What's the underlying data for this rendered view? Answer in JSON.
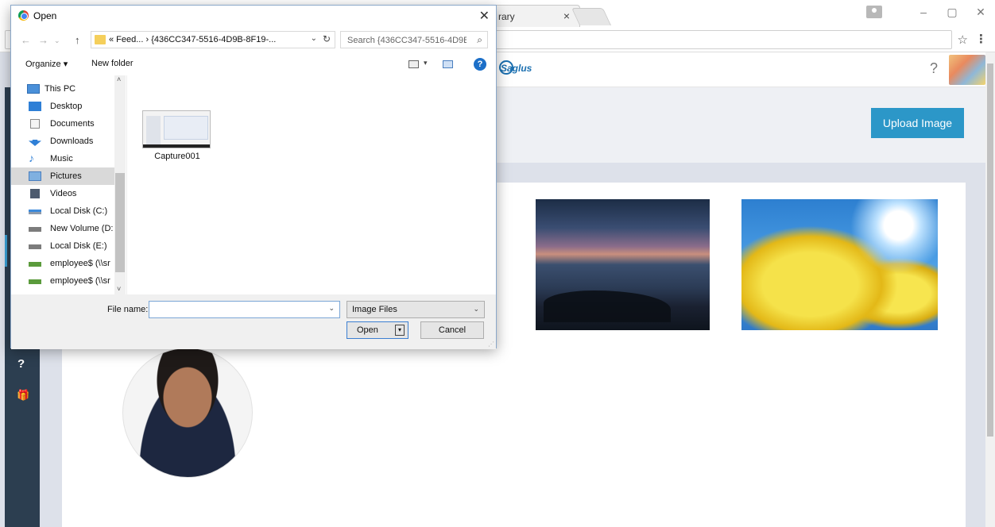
{
  "browser": {
    "active_tab_title": "rary",
    "tab_close": "×",
    "window_minimize": "–",
    "window_restore": "▢",
    "window_close": "✕",
    "star": "☆",
    "menu": "⋮"
  },
  "page": {
    "logo_text": "Saglus",
    "help": "?",
    "upload_button": "Upload Image",
    "sidebar_help": "?",
    "sidebar_gift": "🎁"
  },
  "dialog": {
    "title": "Open",
    "close": "✕",
    "nav": {
      "back": "←",
      "forward": "→",
      "recent": "⌄",
      "up": "↑"
    },
    "path": "« Feed... › {436CC347-5516-4D9B-8F19-...",
    "path_dropdown": "⌄",
    "refresh": "↻",
    "search_placeholder": "Search {436CC347-5516-4D9B...",
    "search_icon": "⌕",
    "organize": "Organize ▾",
    "new_folder": "New folder",
    "view_drop": "▾",
    "help": "?",
    "nav_items": [
      {
        "label": "This PC",
        "icon": "computer-icon"
      },
      {
        "label": "Desktop",
        "icon": "desktop-icon"
      },
      {
        "label": "Documents",
        "icon": "documents-icon"
      },
      {
        "label": "Downloads",
        "icon": "downloads-icon"
      },
      {
        "label": "Music",
        "icon": "music-icon"
      },
      {
        "label": "Pictures",
        "icon": "pictures-icon",
        "selected": true
      },
      {
        "label": "Videos",
        "icon": "videos-icon"
      },
      {
        "label": "Local Disk (C:)",
        "icon": "drive-icon"
      },
      {
        "label": "New Volume (D:",
        "icon": "drive-icon"
      },
      {
        "label": "Local Disk (E:)",
        "icon": "drive-icon"
      },
      {
        "label": "employee$ (\\\\sr",
        "icon": "network-drive-icon"
      },
      {
        "label": "employee$ (\\\\sr",
        "icon": "network-drive-icon"
      }
    ],
    "file": {
      "name": "Capture001"
    },
    "filename_label": "File name:",
    "filename_value": "",
    "filename_drop": "⌄",
    "filetype_selected": "Image Files",
    "filetype_drop": "⌄",
    "open_button": "Open",
    "open_split": "▾",
    "cancel_button": "Cancel",
    "scroll_up": "˄",
    "scroll_down": "˅"
  }
}
